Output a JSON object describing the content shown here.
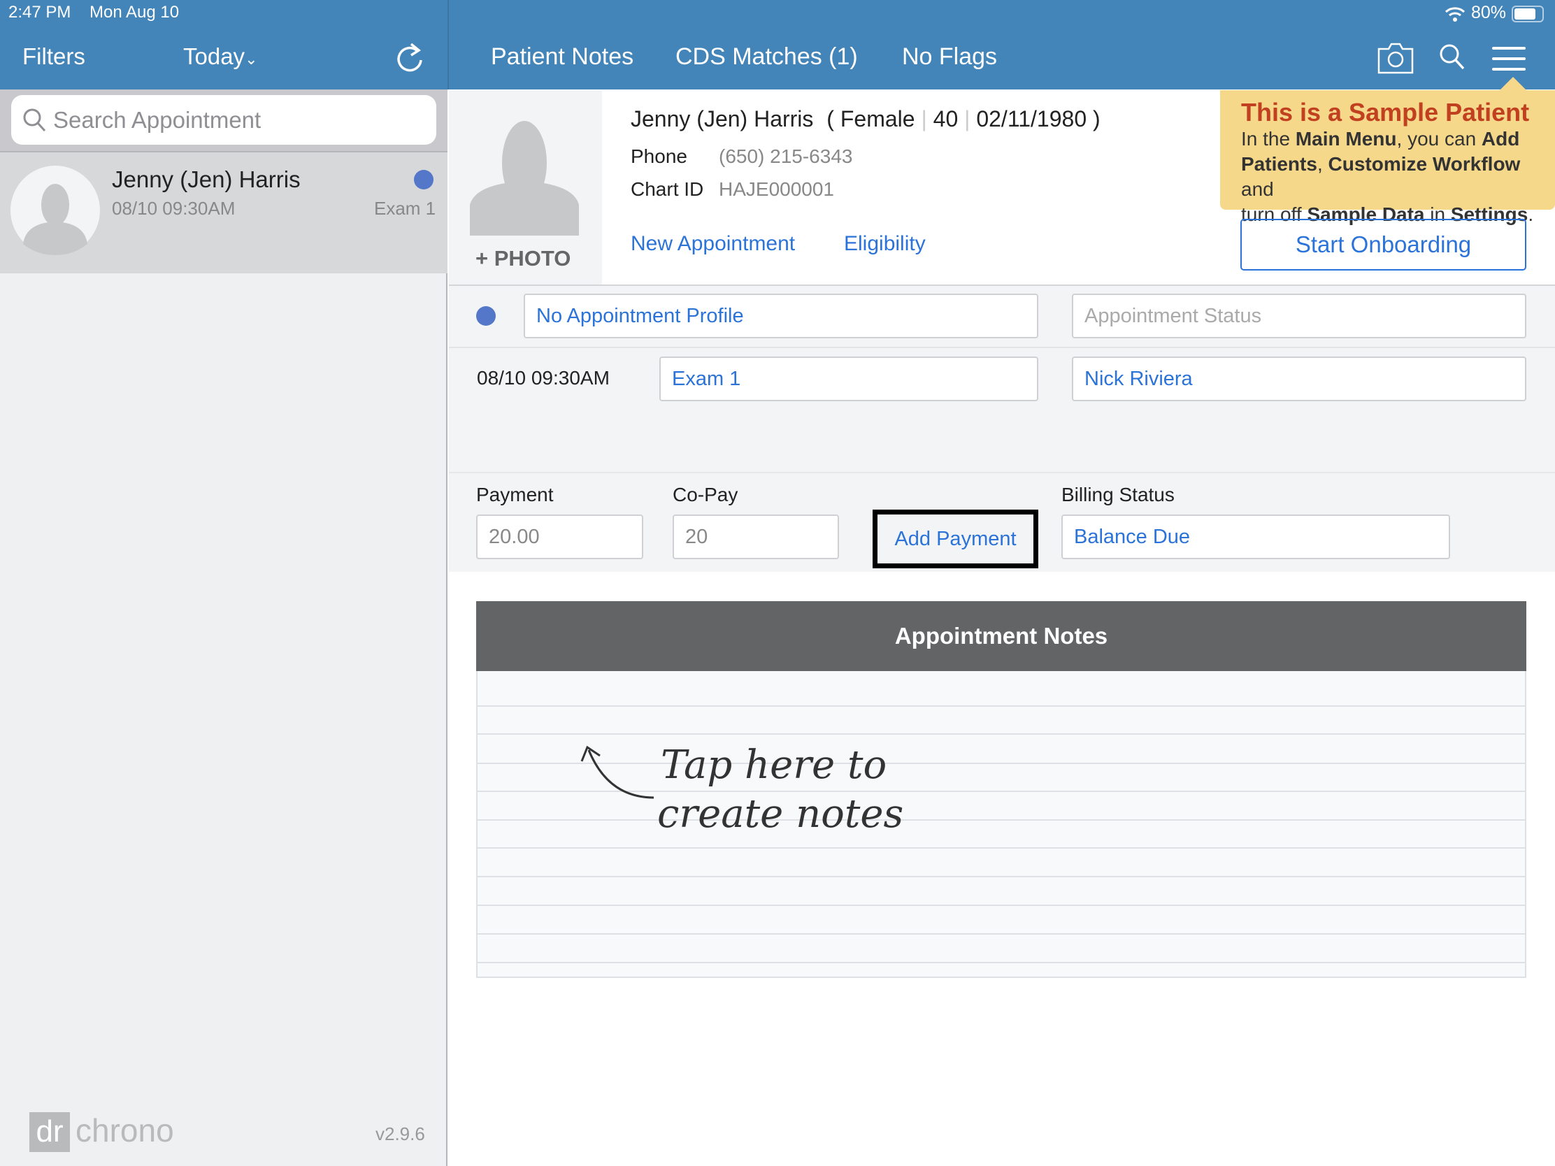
{
  "status_bar": {
    "time": "2:47 PM",
    "date": "Mon Aug 10",
    "battery": "80%",
    "battery_level": 0.8
  },
  "sidebar": {
    "filters": "Filters",
    "today": "Today",
    "today_chevron": "⌄",
    "search_placeholder": "Search Appointment",
    "appointments": [
      {
        "name": "Jenny (Jen) Harris",
        "time": "08/10 09:30AM",
        "room": "Exam 1",
        "status_color": "#5477c9"
      }
    ],
    "logo_dr": "dr",
    "logo_chrono": "chrono",
    "version": "v2.9.6"
  },
  "header": {
    "tabs": [
      "Patient Notes",
      "CDS Matches (1)",
      "No Flags"
    ]
  },
  "patient": {
    "photo_label": "PHOTO",
    "name": "Jenny (Jen) Harris",
    "gender": "Female",
    "age": "40",
    "dob": "02/11/1980",
    "phone_label": "Phone",
    "phone": "(650) 215-6343",
    "chart_label": "Chart ID",
    "chart_id": "HAJE000001",
    "new_appointment": "New Appointment",
    "eligibility": "Eligibility"
  },
  "tooltip": {
    "title": "This is a Sample Patient",
    "line1a": "In the ",
    "line1b": "Main Menu",
    "line1c": ", you can ",
    "line1d": "Add",
    "line2a": "Patients",
    "line2b": ", ",
    "line2c": "Customize Workflow",
    "line2d": " and",
    "line3a": "turn off ",
    "line3b": "Sample Data",
    "line3c": " in ",
    "line3d": "Settings",
    "line3e": "."
  },
  "start_onboarding": "Start Onboarding",
  "appointment": {
    "profile": "No Appointment Profile",
    "status_placeholder": "Appointment Status",
    "datetime": "08/10 09:30AM",
    "room": "Exam 1",
    "provider": "Nick Riviera",
    "status_dot_color": "#5477c9"
  },
  "billing": {
    "payment_label": "Payment",
    "payment": "20.00",
    "copay_label": "Co-Pay",
    "copay": "20",
    "add_payment": "Add Payment",
    "billing_status_label": "Billing Status",
    "billing_status": "Balance Due"
  },
  "notes": {
    "title": "Appointment Notes",
    "hint1": "Tap here to",
    "hint2": "create notes"
  }
}
